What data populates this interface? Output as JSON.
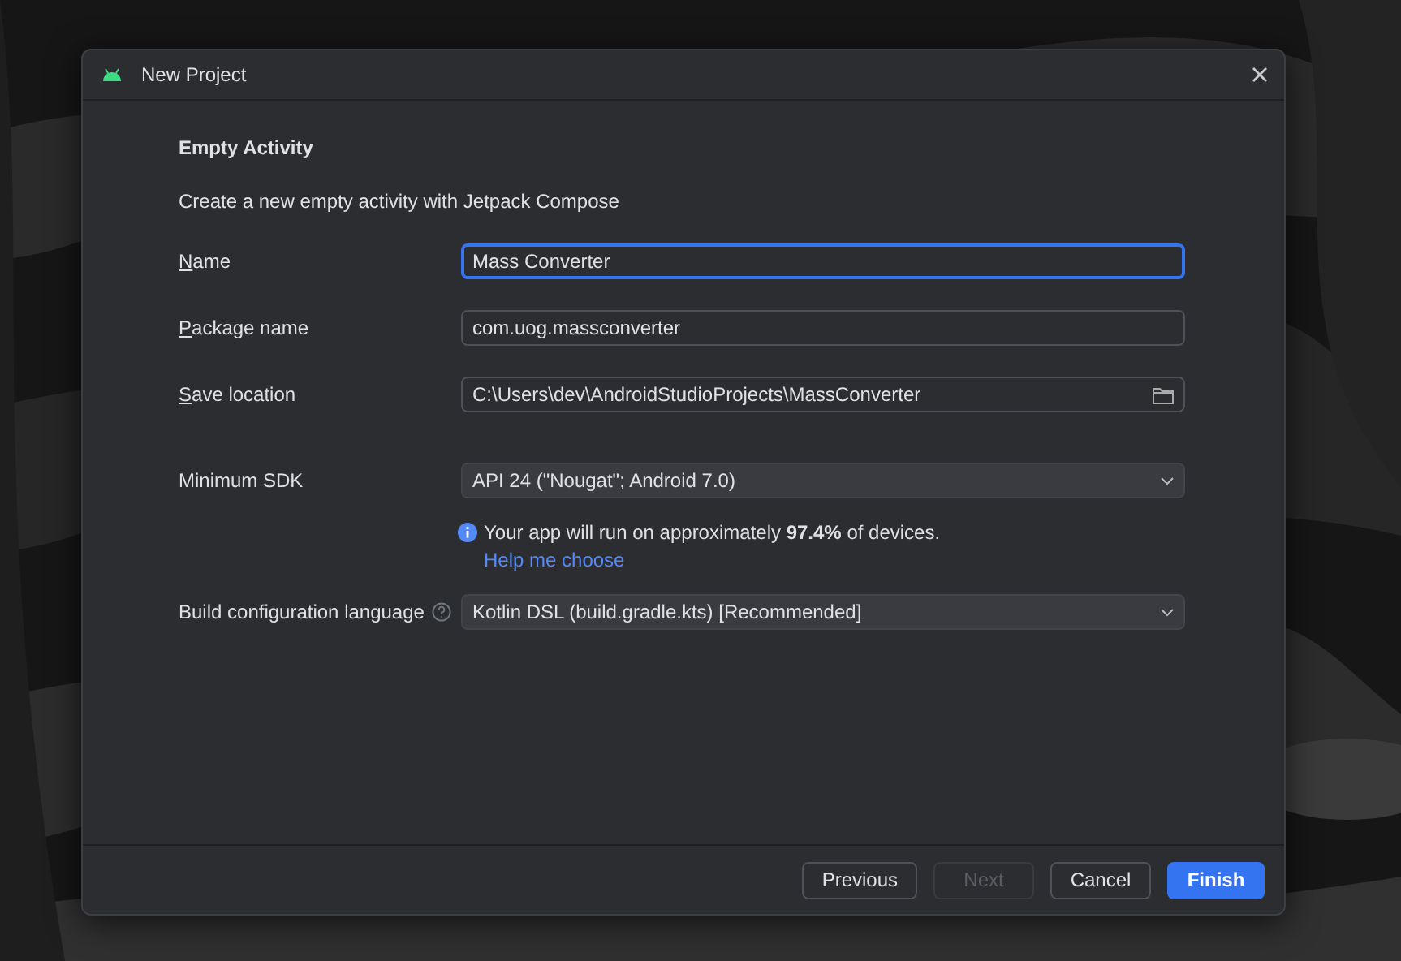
{
  "window": {
    "title": "New Project"
  },
  "heading": "Empty Activity",
  "description": "Create a new empty activity with Jetpack Compose",
  "fields": [
    {
      "kind": "text",
      "label": "Name",
      "mnemonic": true,
      "value": "Mass Converter",
      "focused": true
    },
    {
      "kind": "text",
      "label": "Package name",
      "mnemonic": true,
      "value": "com.uog.massconverter",
      "focused": false
    },
    {
      "kind": "path",
      "label": "Save location",
      "mnemonic": true,
      "value": "C:\\Users\\dev\\AndroidStudioProjects\\MassConverter",
      "focused": false
    },
    {
      "kind": "dropdown",
      "label": "Minimum SDK",
      "mnemonic": false,
      "value": "API 24 (\"Nougat\"; Android 7.0)",
      "focused": false,
      "info": "Your app will run on approximately **97.4%** of devices.",
      "link": "Help me choose"
    },
    {
      "kind": "dropdown",
      "label": "Build configuration language",
      "mnemonic": false,
      "help": true,
      "value": "Kotlin DSL (build.gradle.kts) [Recommended]",
      "focused": false
    }
  ],
  "buttons": [
    {
      "label": "Previous",
      "disabled": false,
      "primary": false
    },
    {
      "label": "Next",
      "disabled": true,
      "primary": false
    },
    {
      "label": "Cancel",
      "disabled": false,
      "primary": false
    },
    {
      "label": "Finish",
      "disabled": false,
      "primary": true
    }
  ]
}
